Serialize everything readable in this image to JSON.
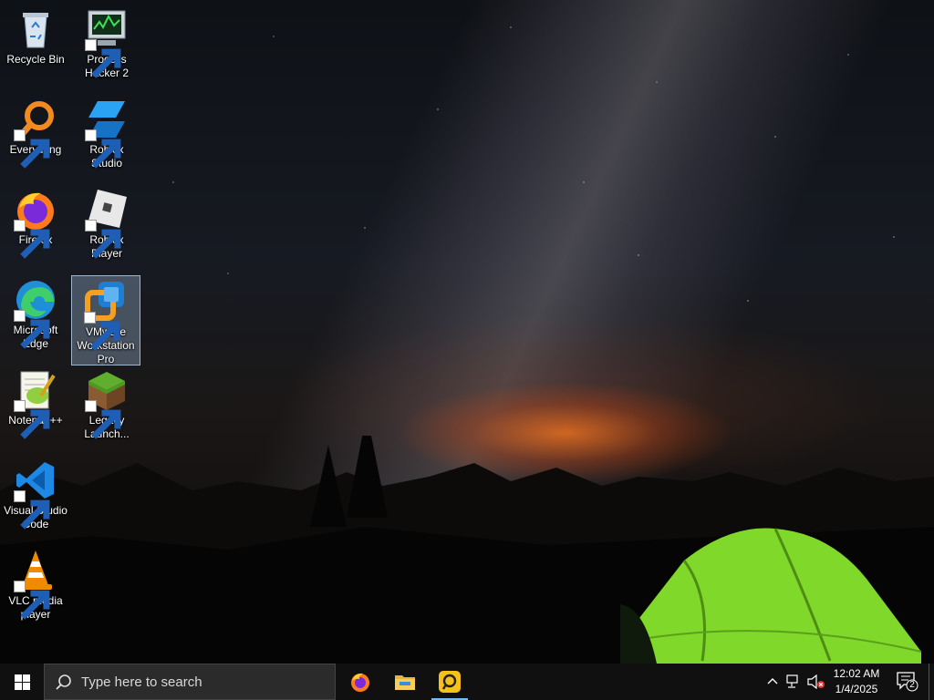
{
  "desktop": {
    "icons": [
      {
        "label": "Recycle Bin",
        "icon": "recycle-bin-icon"
      },
      {
        "label": "Process Hacker 2",
        "icon": "process-hacker-icon"
      },
      {
        "label": "Everything",
        "icon": "everything-search-icon"
      },
      {
        "label": "Roblox Studio",
        "icon": "roblox-studio-icon"
      },
      {
        "label": "Firefox",
        "icon": "firefox-icon"
      },
      {
        "label": "Roblox Player",
        "icon": "roblox-player-icon"
      },
      {
        "label": "Microsoft Edge",
        "icon": "edge-icon"
      },
      {
        "label": "VMware Workstation Pro",
        "icon": "vmware-icon"
      },
      {
        "label": "Notepad++",
        "icon": "notepad-plus-plus-icon"
      },
      {
        "label": "Legacy Launch...",
        "icon": "minecraft-block-icon"
      },
      {
        "label": "Visual Studio Code",
        "icon": "vscode-icon"
      },
      {
        "label": "VLC media player",
        "icon": "vlc-cone-icon"
      }
    ],
    "selected_icon": "VMware Workstation Pro"
  },
  "taskbar": {
    "search_placeholder": "Type here to search",
    "pinned_apps": [
      {
        "name": "Firefox",
        "icon": "firefox-icon"
      },
      {
        "name": "File Explorer",
        "icon": "folder-icon"
      },
      {
        "name": "Roblox Studio",
        "icon": "roblox-yellow-icon",
        "active": true
      }
    ],
    "clock": {
      "time": "12:02 AM",
      "date": "1/4/2025"
    },
    "notification_count": "2"
  },
  "colors": {
    "taskbar_bg": "#101010",
    "selection_bg": "#a0bedc",
    "active_indicator": "#76b9ed",
    "tent": "#7fd82a"
  }
}
